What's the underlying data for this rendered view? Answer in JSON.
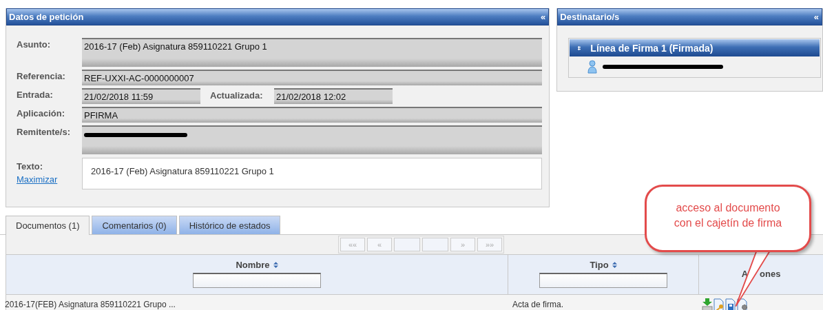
{
  "request_panel": {
    "title": "Datos de petición",
    "collapse": "«",
    "fields": [
      {
        "kind": "area",
        "label": "Asunto:",
        "value": "2016-17 (Feb) Asignatura 859110221 Grupo 1"
      },
      {
        "kind": "line",
        "label": "Referencia:",
        "value": "REF-UXXI-AC-0000000007"
      },
      {
        "kind": "pair",
        "label": "Entrada:",
        "value": "21/02/2018 11:59",
        "label_2": "Actualizada:",
        "value_2": "21/02/2018 12:02"
      },
      {
        "kind": "line",
        "label": "Aplicación:",
        "value": "PFIRMA"
      },
      {
        "kind": "area",
        "label": "Remitente/s:",
        "redacted": true
      }
    ],
    "text_field": {
      "label": "Texto:",
      "link": "Maximizar",
      "value": "2016-17 (Feb) Asignatura 859110221 Grupo 1"
    }
  },
  "recipients_panel": {
    "title": "Destinatario/s",
    "collapse": "«",
    "lines": [
      {
        "title": "Línea de Firma 1 (Firmada)",
        "signers": [
          {
            "redacted": true
          }
        ]
      }
    ]
  },
  "tabs": [
    {
      "label": "Documentos (1)",
      "selected": true
    },
    {
      "label": "Comentarios (0)",
      "selected": false
    },
    {
      "label": "Histórico de estados",
      "selected": false
    }
  ],
  "pager": [
    {
      "label": "««"
    },
    {
      "label": "«"
    },
    {
      "kind": "blank"
    },
    {
      "kind": "blank"
    },
    {
      "label": "»"
    },
    {
      "label": "»»"
    }
  ],
  "table": {
    "columns": [
      {
        "label": "Nombre",
        "sortable": true,
        "filter": true
      },
      {
        "label": "Tipo",
        "sortable": true,
        "filter": true
      },
      {
        "label_parts": [
          "A",
          "ones"
        ]
      }
    ],
    "rows": [
      {
        "name": "2016-17(FEB) Asignatura 859110221 Grupo ...",
        "type": "Acta de firma.",
        "actions": [
          {
            "kind": "download"
          },
          {
            "kind": "key"
          },
          {
            "kind": "save"
          },
          {
            "kind": "gear"
          }
        ]
      }
    ]
  },
  "callout": {
    "lines": [
      "acceso al documento",
      "con el cajetín de firma"
    ]
  }
}
